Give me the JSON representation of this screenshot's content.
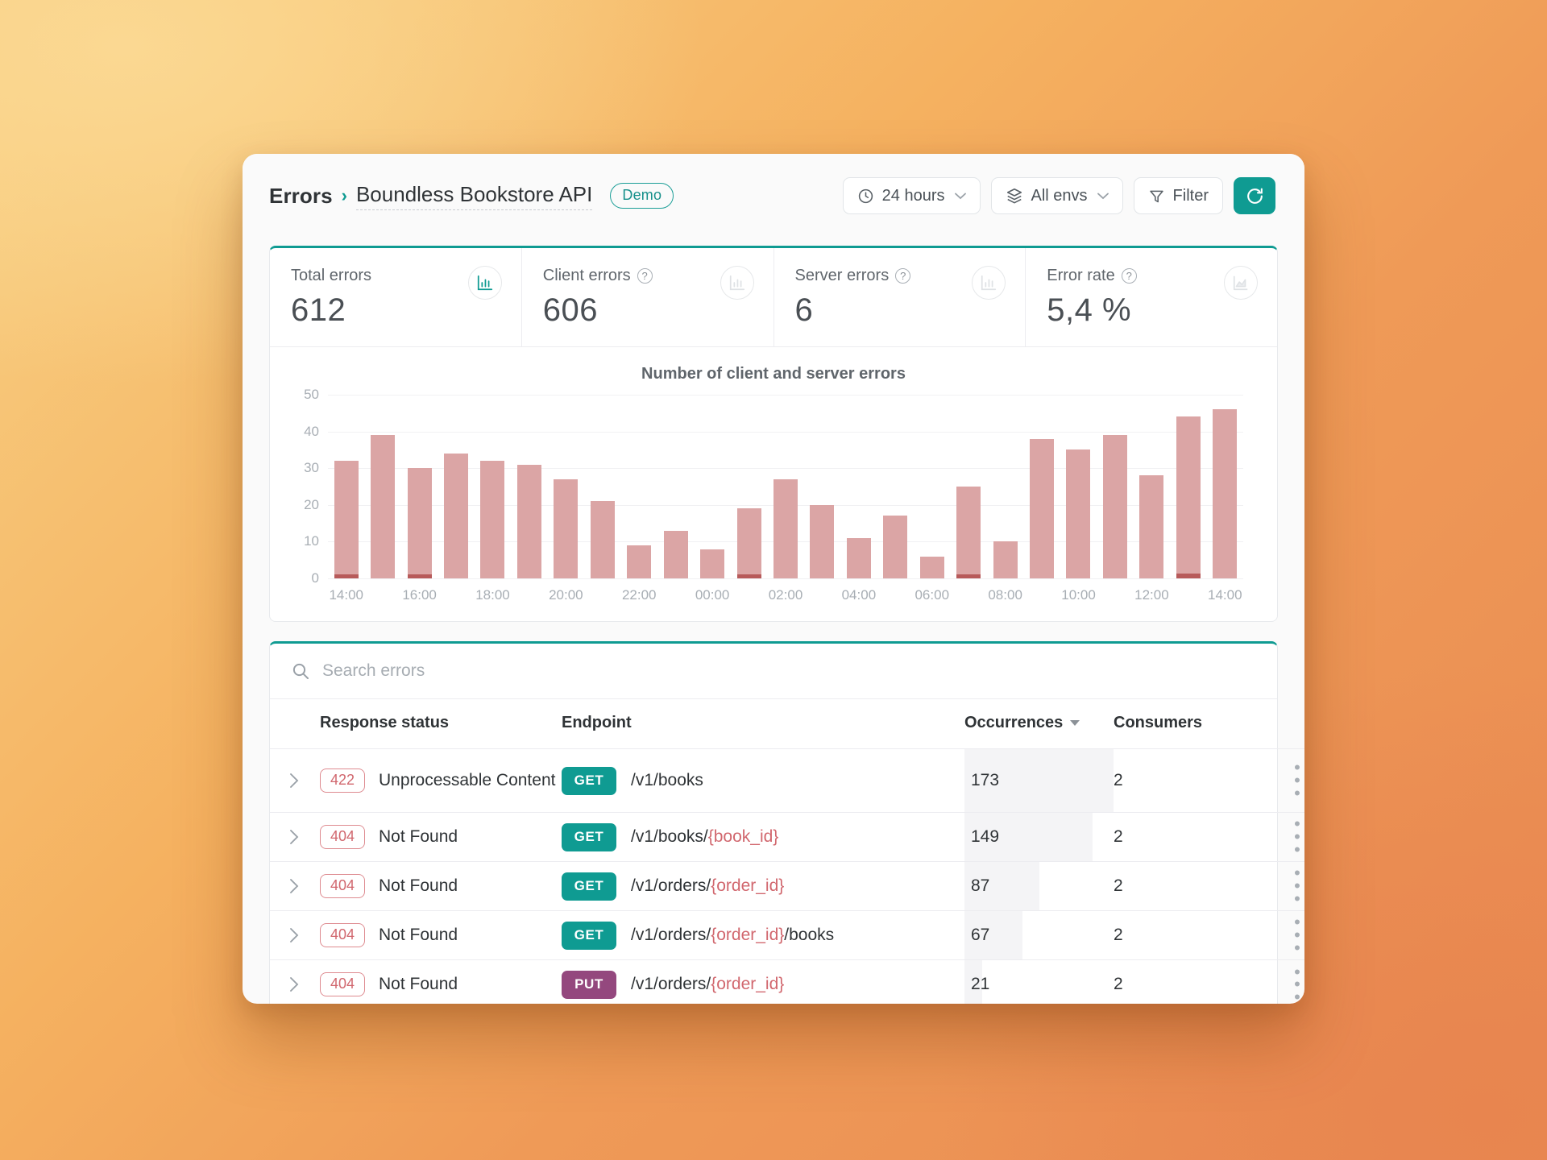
{
  "header": {
    "breadcrumb_root": "Errors",
    "breadcrumb_sep": "›",
    "breadcrumb_current": "Boundless Bookstore API",
    "demo_badge": "Demo",
    "time_range": "24 hours",
    "env_filter": "All envs",
    "filter_label": "Filter",
    "refresh_icon": "refresh-icon",
    "clock_icon": "clock-icon",
    "layers_icon": "layers-icon",
    "funnel_icon": "funnel-icon"
  },
  "stats": [
    {
      "label": "Total errors",
      "value": "612",
      "has_help": false,
      "icon": "bar-chart-icon",
      "icon_active": true
    },
    {
      "label": "Client errors",
      "value": "606",
      "has_help": true,
      "icon": "bar-chart-icon",
      "icon_active": false
    },
    {
      "label": "Server errors",
      "value": "6",
      "has_help": true,
      "icon": "bar-chart-icon",
      "icon_active": false
    },
    {
      "label": "Error rate",
      "value": "5,4 %",
      "has_help": true,
      "icon": "area-chart-icon",
      "icon_active": false
    }
  ],
  "chart_data": {
    "type": "bar",
    "title": "Number of client and server errors",
    "xlabel": "",
    "ylabel": "",
    "ylim": [
      0,
      50
    ],
    "yticks": [
      0,
      10,
      20,
      30,
      40,
      50
    ],
    "grid": true,
    "legend": false,
    "stacked": true,
    "colors": {
      "client": "#dba5a5",
      "server": "#b75a5a"
    },
    "x_tick_labels": [
      "14:00",
      "16:00",
      "18:00",
      "20:00",
      "22:00",
      "00:00",
      "02:00",
      "04:00",
      "06:00",
      "08:00",
      "10:00",
      "12:00",
      "14:00"
    ],
    "categories": [
      "14:00",
      "15:00",
      "16:00",
      "17:00",
      "18:00",
      "19:00",
      "20:00",
      "21:00",
      "22:00",
      "23:00",
      "00:00",
      "01:00",
      "02:00",
      "03:00",
      "04:00",
      "05:00",
      "06:00",
      "07:00",
      "08:00",
      "09:00",
      "10:00",
      "11:00",
      "12:00",
      "13:00",
      "14:00"
    ],
    "series": [
      {
        "name": "Client errors",
        "values": [
          31,
          39,
          29,
          34,
          32,
          31,
          27,
          21,
          9,
          13,
          8,
          18,
          27,
          20,
          11,
          17,
          6,
          24,
          10,
          38,
          35,
          39,
          28,
          43,
          46
        ]
      },
      {
        "name": "Server errors",
        "values": [
          1,
          0,
          1,
          0,
          0,
          0,
          0,
          0,
          0,
          0,
          0,
          1,
          0,
          0,
          0,
          0,
          0,
          1,
          0,
          0,
          0,
          0,
          0,
          1,
          0
        ]
      }
    ]
  },
  "search": {
    "placeholder": "Search errors",
    "value": "",
    "icon": "search-icon"
  },
  "table": {
    "columns": {
      "status": "Response status",
      "endpoint": "Endpoint",
      "occurrences": "Occurrences",
      "consumers": "Consumers"
    },
    "sorted_by": "Occurrences",
    "sort_direction": "desc",
    "max_occurrences": 173,
    "rows": [
      {
        "code": "422",
        "status": "Unprocessable Content",
        "method": "GET",
        "path_prefix": "/v1/books",
        "path_param": "",
        "path_suffix": "",
        "occurrences": "173",
        "consumers": "2"
      },
      {
        "code": "404",
        "status": "Not Found",
        "method": "GET",
        "path_prefix": "/v1/books/",
        "path_param": "{book_id}",
        "path_suffix": "",
        "occurrences": "149",
        "consumers": "2"
      },
      {
        "code": "404",
        "status": "Not Found",
        "method": "GET",
        "path_prefix": "/v1/orders/",
        "path_param": "{order_id}",
        "path_suffix": "",
        "occurrences": "87",
        "consumers": "2"
      },
      {
        "code": "404",
        "status": "Not Found",
        "method": "GET",
        "path_prefix": "/v1/orders/",
        "path_param": "{order_id}",
        "path_suffix": "/books",
        "occurrences": "67",
        "consumers": "2"
      },
      {
        "code": "404",
        "status": "Not Found",
        "method": "PUT",
        "path_prefix": "/v1/orders/",
        "path_param": "{order_id}",
        "path_suffix": "",
        "occurrences": "21",
        "consumers": "2"
      }
    ]
  },
  "colors": {
    "accent": "#0f9b92",
    "client_error_bar": "#dba5a5",
    "server_error_bar": "#b75a5a",
    "status_pill": "#d1676e",
    "verb_get": "#0f9b92",
    "verb_put": "#94487e"
  }
}
